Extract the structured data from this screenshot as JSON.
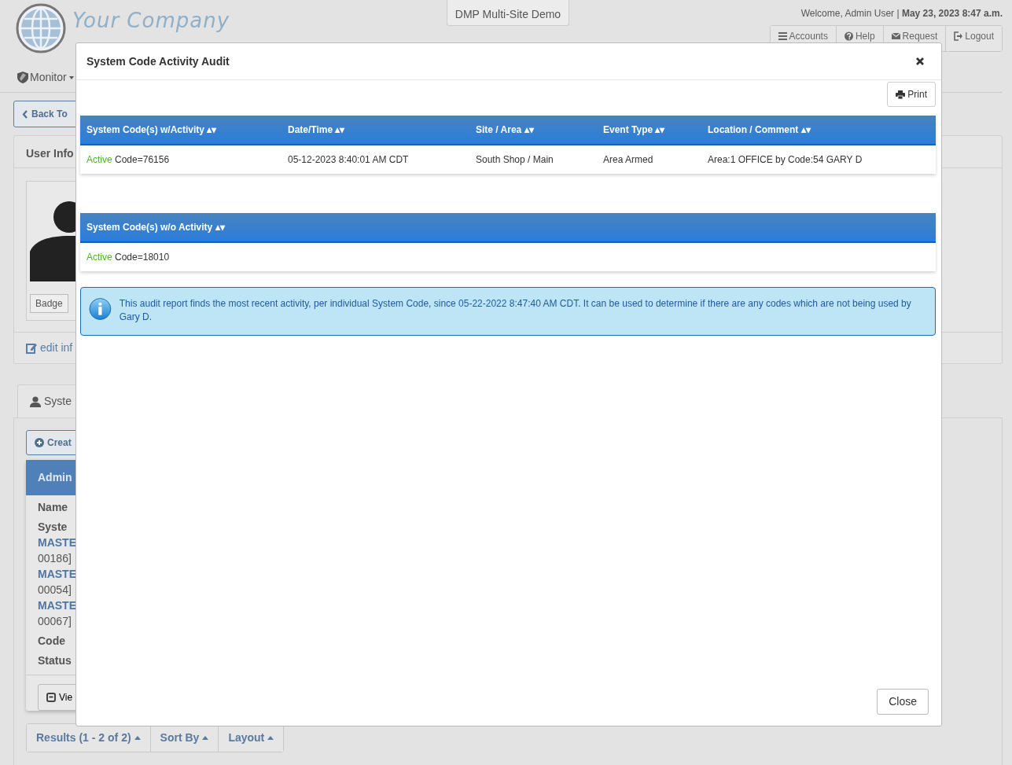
{
  "header": {
    "logo_lines": [
      "Your Company"
    ],
    "site_tab": "DMP Multi-Site Demo",
    "welcome": "Welcome, Admin User | **May 23, 2023 8:47 a.m.**",
    "nav_buttons": [
      {
        "kind": "list",
        "label": "Accounts"
      },
      {
        "kind": "help",
        "label": "Help"
      },
      {
        "kind": "mail",
        "label": "Request"
      },
      {
        "kind": "logout",
        "label": "Logout"
      }
    ]
  },
  "menu": [
    {
      "label": "Monitor"
    }
  ],
  "back_button": "Back To",
  "user_info": {
    "title": "User Info",
    "badge_button": "Badge",
    "edit_link": "edit inf"
  },
  "tabs": [
    {
      "label": "Syste",
      "selected": true
    }
  ],
  "create_button": "Creat",
  "admin_card": {
    "title": "Admin",
    "fields": [
      {
        "kind": "label",
        "text": "Name"
      },
      {
        "kind": "label",
        "text": "Syste"
      },
      {
        "kind": "link",
        "text": "MASTE"
      },
      {
        "kind": "text",
        "text": "00186]"
      },
      {
        "kind": "link",
        "text": "MASTE"
      },
      {
        "kind": "text",
        "text": "00054]"
      },
      {
        "kind": "link",
        "text": "MASTE"
      },
      {
        "kind": "text",
        "text": "00067]"
      },
      {
        "kind": "label",
        "text": "Code"
      },
      {
        "kind": "label",
        "text": "Status"
      }
    ],
    "view_button": "Vie"
  },
  "bottom_bar": [
    {
      "label": "Results (1 - 2 of 2)"
    },
    {
      "label": "Sort By"
    },
    {
      "label": "Layout"
    }
  ],
  "modal": {
    "title": "System Code Activity Audit",
    "print_button": "Print",
    "tables": [
      {
        "columns": [
          "System Code(s) w/Activity ▴▾",
          "Date/Time ▴▾",
          "Site / Area ▴▾",
          "Event Type ▴▾",
          "Location / Comment ▴▾"
        ],
        "rows": [
          {
            "status": "Active",
            "cells": [
              "Code=76156",
              "05-12-2023 8:40:01 AM CDT",
              "South Shop / Main",
              "Area Armed",
              "Area:1 OFFICE by Code:54 GARY D"
            ]
          }
        ]
      },
      {
        "columns": [
          "System Code(s) w/o Activity ▴▾"
        ],
        "rows": [
          {
            "status": "Active",
            "cells": [
              "Code=18010"
            ]
          }
        ]
      }
    ],
    "info": "This audit report finds the most recent activity, per individual System Code, since 05-22-2022 8:47:40 AM CDT. It can be used to determine if there are any codes which are not being used by Gary D.",
    "close_button": "Close"
  }
}
